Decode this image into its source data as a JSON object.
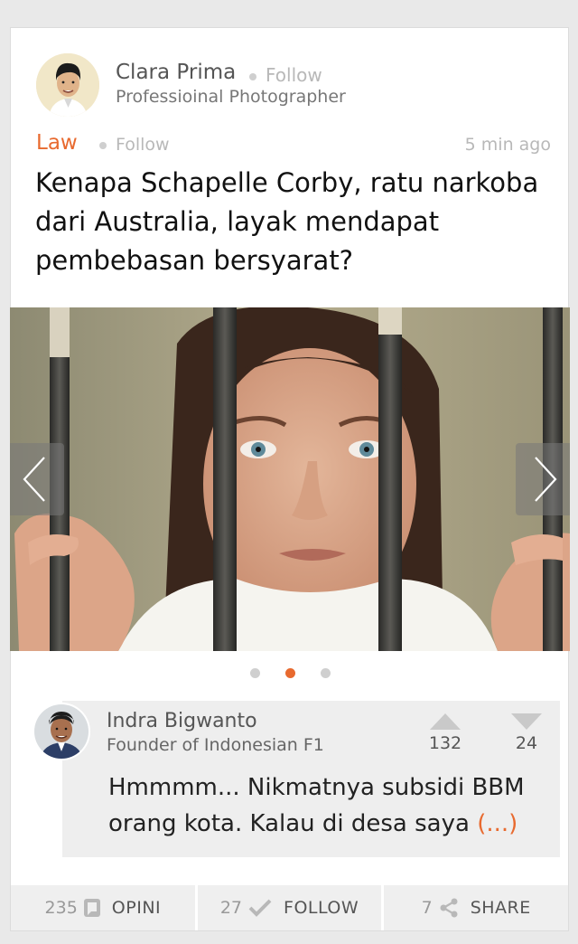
{
  "author": {
    "name": "Clara Prima",
    "follow_label": "Follow",
    "title": "Professioinal Photographer"
  },
  "post": {
    "category": "Law",
    "category_follow_label": "Follow",
    "timestamp": "5 min ago",
    "headline": "Kenapa Schapelle Corby, ratu narkoba dari Australia, layak mendapat pembebasan bersyarat?"
  },
  "carousel": {
    "total_slides": 3,
    "active_index": 1
  },
  "comment": {
    "name": "Indra Bigwanto",
    "title": "Founder of Indonesian F1",
    "upvotes": "132",
    "downvotes": "24",
    "text": "Hmmmm... Nikmatnya subsidi BBM orang kota. Kalau di desa saya ",
    "more_label": "(...)"
  },
  "footer": {
    "opini": {
      "count": "235",
      "label": "OPINI",
      "icon": "comment-icon"
    },
    "follow": {
      "count": "27",
      "label": "FOLLOW",
      "icon": "checkmark-icon"
    },
    "share": {
      "count": "7",
      "label": "SHARE",
      "icon": "share-icon"
    }
  },
  "colors": {
    "accent": "#e86a2f",
    "background": "#e9e9e9",
    "panel": "#eeeeee"
  }
}
